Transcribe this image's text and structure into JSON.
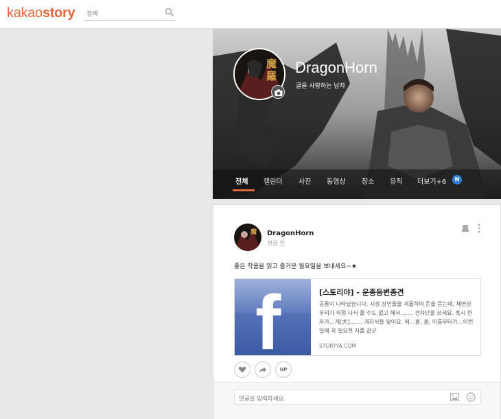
{
  "header": {
    "logo_part1": "kakao",
    "logo_part2": "story",
    "search_placeholder": "검색"
  },
  "profile": {
    "name": "DragonHorn",
    "status": "글을 사랑하는 남자",
    "avatar_text": "魔羅"
  },
  "tabs": [
    {
      "label": "전체",
      "active": true
    },
    {
      "label": "캘린더"
    },
    {
      "label": "사진"
    },
    {
      "label": "동영상"
    },
    {
      "label": "장소"
    },
    {
      "label": "뮤직"
    },
    {
      "label": "더보기+6"
    }
  ],
  "tabs_badge": "N",
  "post": {
    "author": "DragonHorn",
    "time": "방금 전",
    "text": "좋은 작품을 읽고 즐거운 월요일을 보내세요~★",
    "link": {
      "title": "[스토리야] - 운종등변종견",
      "description": "공룡이 나타났습니다. 시장 상인들을 괴롭히며 돈을 뜯는데, 체면상 우리가 직접 나서 줄 수도 없고 해서……. 견자단을 쓰세요. 혹시 한자가…개[犬]……. 개차식들 맞아요. 에…흠, 흠, 이름부터가…이런 일에 꼭 필요한 자를 같군",
      "domain": "STORYYA.COM"
    },
    "up_label": "UP",
    "comment_placeholder": "댓글을 입력하세요."
  },
  "colors": {
    "accent": "#e0673b",
    "badge": "#2f7fd6",
    "facebook": "#3b5aa3"
  }
}
